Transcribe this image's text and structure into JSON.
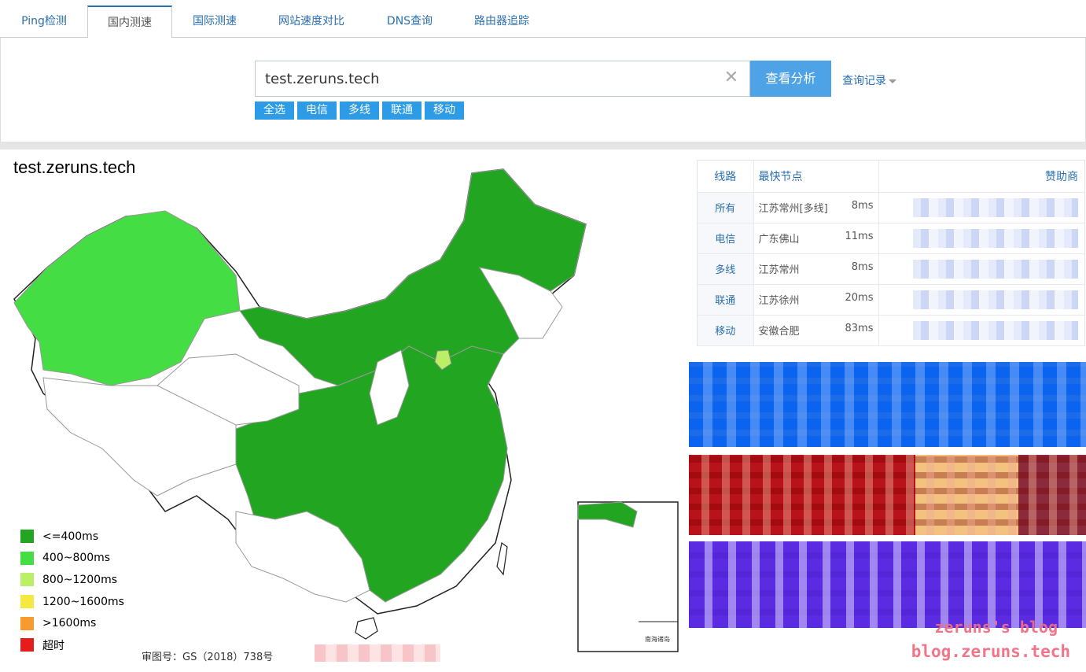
{
  "tabs": [
    {
      "label": "Ping检测",
      "active": false
    },
    {
      "label": "国内测速",
      "active": true
    },
    {
      "label": "国际测速",
      "active": false
    },
    {
      "label": "网站速度对比",
      "active": false
    },
    {
      "label": "DNS查询",
      "active": false
    },
    {
      "label": "路由器追踪",
      "active": false
    }
  ],
  "search": {
    "value": "test.zeruns.tech",
    "clear_icon": "close-icon",
    "button_label": "查看分析",
    "history_label": "查询记录"
  },
  "filters": [
    "全选",
    "电信",
    "多线",
    "联通",
    "移动"
  ],
  "map": {
    "title": "test.zeruns.tech",
    "approval_number": "审图号：GS（2018）738号",
    "legend": [
      {
        "label": "<=400ms",
        "color": "#22a622"
      },
      {
        "label": "400~800ms",
        "color": "#44dd44"
      },
      {
        "label": "800~1200ms",
        "color": "#bbf066"
      },
      {
        "label": "1200~1600ms",
        "color": "#f5e840"
      },
      {
        "label": ">1600ms",
        "color": "#f79a30"
      },
      {
        "label": "超时",
        "color": "#e51c1c"
      }
    ],
    "inset_label": "南海诸岛"
  },
  "results": {
    "headers": {
      "line": "线路",
      "node": "最快节点",
      "sponsor": "赞助商"
    },
    "rows": [
      {
        "line": "所有",
        "node": "江苏常州[多线]",
        "time": "8ms"
      },
      {
        "line": "电信",
        "node": "广东佛山",
        "time": "11ms"
      },
      {
        "line": "多线",
        "node": "江苏常州",
        "time": "8ms"
      },
      {
        "line": "联通",
        "node": "江苏徐州",
        "time": "20ms"
      },
      {
        "line": "移动",
        "node": "安徽合肥",
        "time": "83ms"
      }
    ]
  },
  "watermark": {
    "line1": "zeruns's blog",
    "line2": "blog.zeruns.tech"
  }
}
